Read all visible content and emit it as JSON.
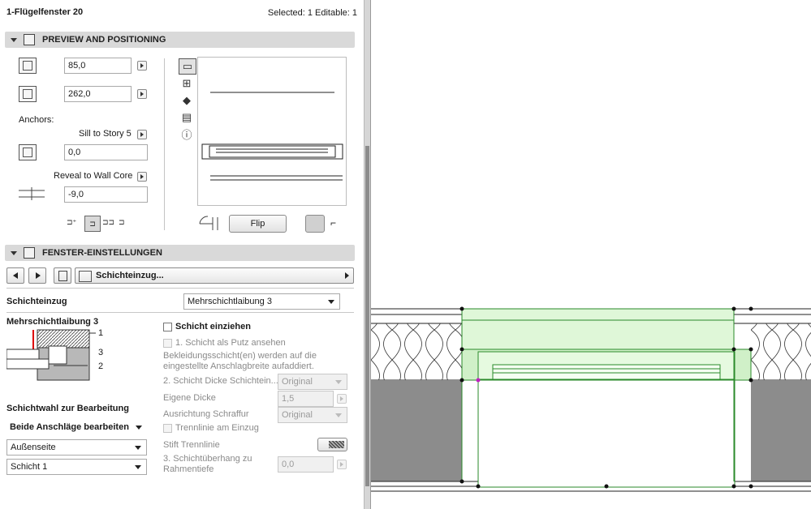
{
  "header": {
    "title": "1-Flügelfenster 20",
    "status": "Selected: 1 Editable: 1"
  },
  "preview_section": {
    "title": "PREVIEW AND POSITIONING",
    "width_value": "85,0",
    "height_value": "262,0",
    "anchors_label": "Anchors:",
    "sill_label": "Sill to Story 5",
    "sill_value": "0,0",
    "reveal_label": "Reveal to Wall Core",
    "reveal_value": "-9,0",
    "flip_label": "Flip"
  },
  "fenster_section": {
    "title": "FENSTER-EINSTELLUNGEN",
    "page_select": "Schichteinzug...",
    "schichteinzug_label": "Schichteinzug",
    "schichteinzug_value": "Mehrschichtlaibung 3",
    "diagram_title": "Mehrschichtlaibung 3",
    "diagram_labels": [
      "1",
      "3",
      "2"
    ],
    "schichtwahl_label": "Schichtwahl zur Bearbeitung",
    "schichtwahl_options": [
      "Beide Anschläge bearbeiten",
      "Außenseite",
      "Schicht 1"
    ],
    "schicht_einziehen": "Schicht einziehen",
    "putz_label": "1. Schicht als Putz ansehen",
    "info_text_1": "Bekleidungsschicht(en) werden auf die",
    "info_text_2": "eingestellte Anschlagbreite aufaddiert.",
    "dicke_schicht_label": "2. Schicht Dicke Schichtein...",
    "dicke_schicht_value": "Original",
    "eigene_dicke_label": "Eigene Dicke",
    "eigene_dicke_value": "1,5",
    "ausrichtung_label": "Ausrichtung Schraffur",
    "ausrichtung_value": "Original",
    "trennlinie_label": "Trennlinie am Einzug",
    "stift_label": "Stift Trennlinie",
    "ueberhang_label_1": "3. Schichtüberhang zu",
    "ueberhang_label_2": "Rahmentiefe",
    "ueberhang_value": "0,0"
  },
  "colors": {
    "window_fill": "#d9f7d2",
    "window_stroke": "#2a8a2a",
    "wall_core": "#8c8c8c",
    "header_bg": "#d9d9d9"
  }
}
